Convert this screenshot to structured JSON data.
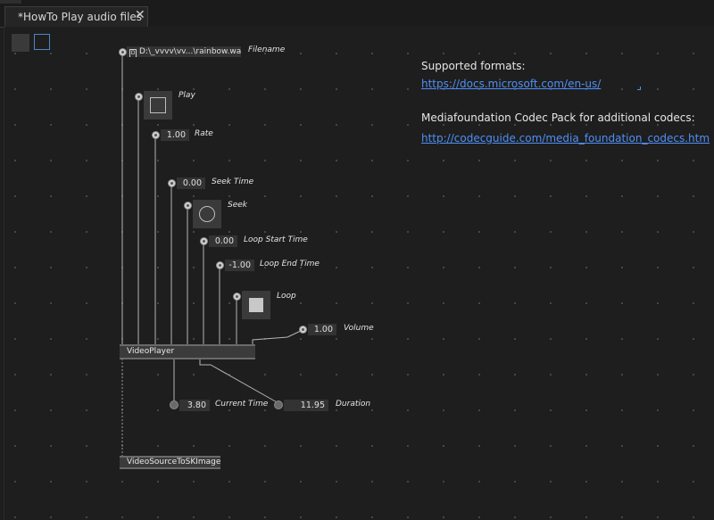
{
  "tab": {
    "title": "*HowTo Play audio files",
    "close_glyph": "✕"
  },
  "filename": {
    "icon_glyph": "D",
    "value": "D:\\_vvvv\\vv...\\rainbow.wav",
    "label": "Filename"
  },
  "inputs": {
    "play": "Play",
    "rate_value": "1.00",
    "rate": "Rate",
    "seek_time_value": "0.00",
    "seek_time": "Seek Time",
    "seek": "Seek",
    "loop_start_value": "0.00",
    "loop_start": "Loop Start Time",
    "loop_end_value": "-1.00",
    "loop_end": "Loop End Time",
    "loop": "Loop",
    "volume_value": "1.00",
    "volume": "Volume"
  },
  "nodes": {
    "player": "VideoPlayer",
    "converter": "VideoSourceToSKImage"
  },
  "outputs": {
    "current_time_value": "3.80",
    "current_time": "Current Time",
    "duration_value": "11.95",
    "duration": "Duration"
  },
  "docs": {
    "supported_formats": "Supported formats:",
    "link1": "https://docs.microsoft.com/en-us/",
    "codec_pack": "Mediafoundation Codec Pack for additional codecs:",
    "link2": "http://codecguide.com/media_foundation_codecs.htm"
  },
  "colors": {
    "accent": "#4a86c8",
    "link": "#4f8ff7",
    "background": "#1e1e1e"
  }
}
